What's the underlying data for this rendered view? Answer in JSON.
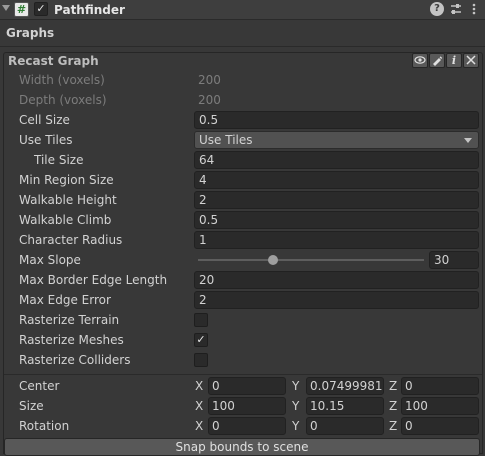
{
  "component": {
    "title": "Pathfinder",
    "enabled": true,
    "script_icon": "#",
    "icons": [
      "help-icon",
      "settings-icon",
      "more-icon"
    ]
  },
  "graphs_title": "Graphs",
  "graph": {
    "title": "Recast Graph",
    "toolbar_icons": [
      "eye-icon",
      "edit-icon",
      "info-icon",
      "close-icon"
    ],
    "info_glyph": "i",
    "fields": {
      "width": {
        "label": "Width (voxels)",
        "value": "200"
      },
      "depth": {
        "label": "Depth (voxels)",
        "value": "200"
      },
      "cell_size": {
        "label": "Cell Size",
        "value": "0.5"
      },
      "use_tiles": {
        "label": "Use Tiles",
        "value": "Use Tiles"
      },
      "tile_size": {
        "label": "Tile Size",
        "value": "64"
      },
      "min_region_size": {
        "label": "Min Region Size",
        "value": "4"
      },
      "walkable_height": {
        "label": "Walkable Height",
        "value": "2"
      },
      "walkable_climb": {
        "label": "Walkable Climb",
        "value": "0.5"
      },
      "character_radius": {
        "label": "Character Radius",
        "value": "1"
      },
      "max_slope": {
        "label": "Max Slope",
        "value": "30",
        "slider_min": 0,
        "slider_max": 90
      },
      "max_border_edge_length": {
        "label": "Max Border Edge Length",
        "value": "20"
      },
      "max_edge_error": {
        "label": "Max Edge Error",
        "value": "2"
      },
      "rasterize_terrain": {
        "label": "Rasterize Terrain",
        "checked": false
      },
      "rasterize_meshes": {
        "label": "Rasterize Meshes",
        "checked": true
      },
      "rasterize_colliders": {
        "label": "Rasterize Colliders",
        "checked": false
      }
    },
    "bounds": {
      "center": {
        "label": "Center",
        "x": "0",
        "y": "0.07499981",
        "z": "0"
      },
      "size": {
        "label": "Size",
        "x": "100",
        "y": "10.15",
        "z": "100"
      },
      "rotation": {
        "label": "Rotation",
        "x": "0",
        "y": "0",
        "z": "0"
      }
    },
    "axis_labels": {
      "x": "X",
      "y": "Y",
      "z": "Z"
    },
    "snap_button": "Snap bounds to scene"
  },
  "check_mark": "✓"
}
